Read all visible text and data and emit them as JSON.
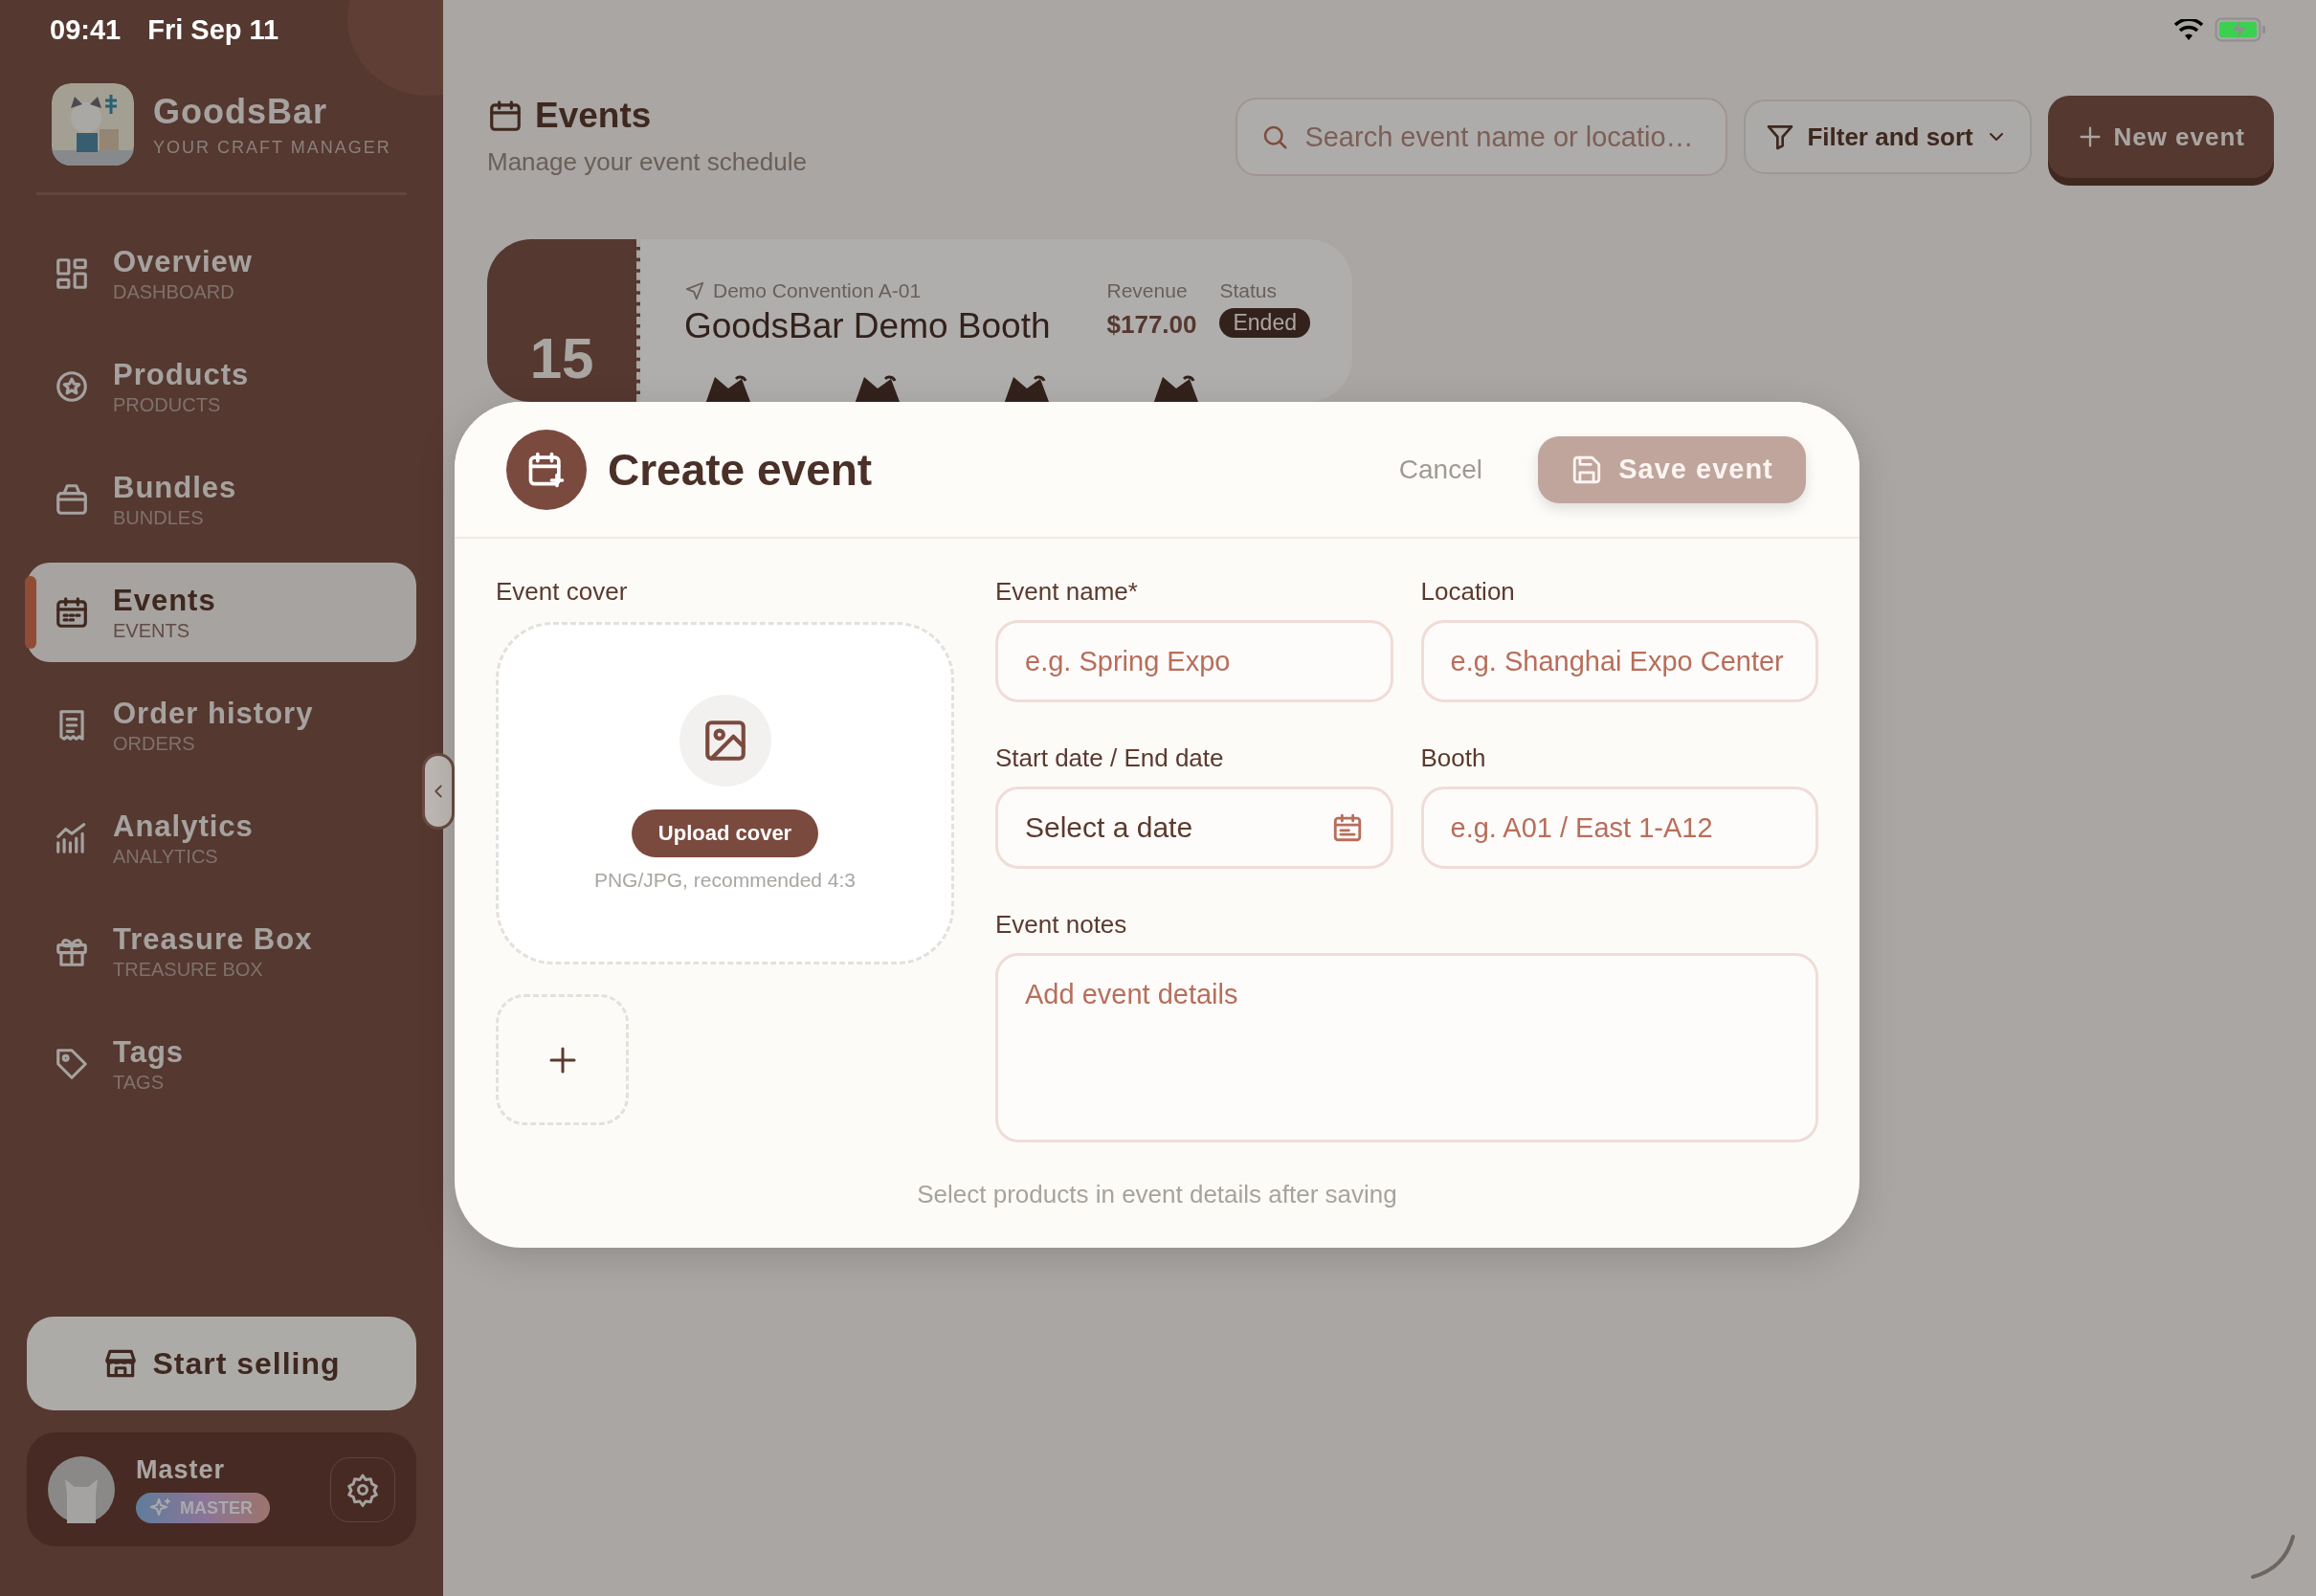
{
  "status_bar": {
    "time": "09:41",
    "date": "Fri Sep 11"
  },
  "app": {
    "name": "GoodsBar",
    "tagline": "YOUR CRAFT MANAGER"
  },
  "sidebar": {
    "items": [
      {
        "label": "Overview",
        "sublabel": "DASHBOARD",
        "selected": false
      },
      {
        "label": "Products",
        "sublabel": "PRODUCTS",
        "selected": false
      },
      {
        "label": "Bundles",
        "sublabel": "BUNDLES",
        "selected": false
      },
      {
        "label": "Events",
        "sublabel": "EVENTS",
        "selected": true
      },
      {
        "label": "Order history",
        "sublabel": "ORDERS",
        "selected": false
      },
      {
        "label": "Analytics",
        "sublabel": "ANALYTICS",
        "selected": false
      },
      {
        "label": "Treasure Box",
        "sublabel": "TREASURE BOX",
        "selected": false
      },
      {
        "label": "Tags",
        "sublabel": "TAGS",
        "selected": false
      }
    ],
    "start_selling": "Start selling",
    "user": {
      "name": "Master",
      "badge": "MASTER"
    }
  },
  "header": {
    "title": "Events",
    "subtitle": "Manage your event schedule",
    "search": {
      "placeholder": "Search event name or locatio…"
    },
    "filter": "Filter and sort",
    "new_event": "New event"
  },
  "events": [
    {
      "day": "15",
      "location": "Demo Convention A-01",
      "name": "GoodsBar Demo Booth",
      "revenue_label": "Revenue",
      "revenue": "$177.00",
      "status_label": "Status",
      "status": "Ended"
    }
  ],
  "modal": {
    "title": "Create event",
    "cancel": "Cancel",
    "save": {
      "label": "Save event",
      "disabled": true
    },
    "cover": {
      "label": "Event cover",
      "button": "Upload cover",
      "hint": "PNG/JPG, recommended 4:3"
    },
    "fields": [
      {
        "kind": "text",
        "label": "Event name*",
        "placeholder": "e.g. Spring Expo"
      },
      {
        "kind": "text",
        "label": "Location",
        "placeholder": "e.g. Shanghai Expo Center"
      },
      {
        "kind": "date",
        "label": "Start date / End date",
        "value": "Select a date"
      },
      {
        "kind": "text",
        "label": "Booth",
        "placeholder": "e.g. A01 / East 1-A12"
      },
      {
        "kind": "textarea",
        "label": "Event notes",
        "placeholder": "Add event details"
      }
    ],
    "footer_note": "Select products in event details after saving"
  }
}
